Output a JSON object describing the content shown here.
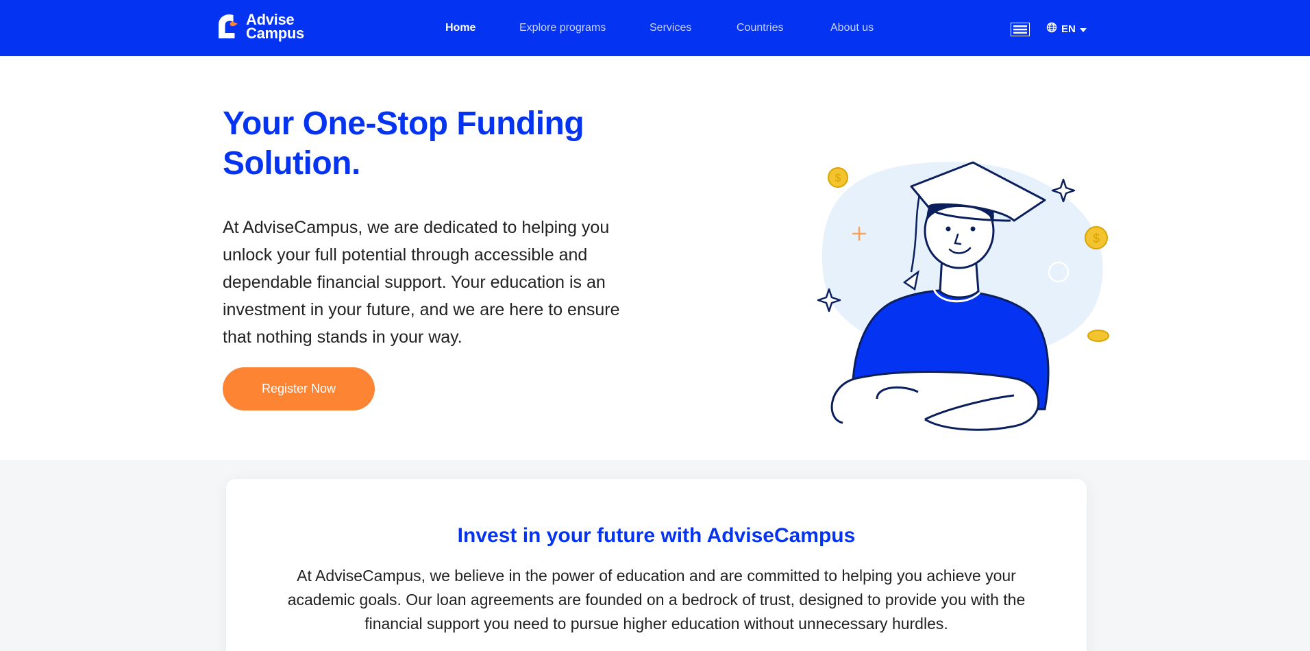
{
  "brand": {
    "line1": "Advise",
    "line2": "Campus",
    "colors": {
      "primary": "#0433f2",
      "accent": "#fd8433",
      "text": "#222222"
    }
  },
  "nav": {
    "links": [
      {
        "label": "Home",
        "active": true
      },
      {
        "label": "Explore programs",
        "active": false
      },
      {
        "label": "Services",
        "active": false
      },
      {
        "label": "Countries",
        "active": false
      },
      {
        "label": "About us",
        "active": false
      }
    ],
    "menu_icon": "hamburger-menu-icon",
    "language_icon": "globe-icon",
    "language": "EN",
    "language_dropdown_icon": "caret-down-icon"
  },
  "hero": {
    "title": "Your One-Stop Funding Solution.",
    "text": "At AdviseCampus, we are dedicated to helping you unlock your full potential through accessible and dependable financial support. Your education is an investment in your future, and we are here to ensure that nothing stands in your way.",
    "cta": "Register Now",
    "illustration_icon": "student-graduate-illustration"
  },
  "invest": {
    "title": "Invest in your future with AdviseCampus",
    "text": "At AdviseCampus, we believe in the power of education and are committed to helping you achieve your academic goals. Our loan agreements are founded on a bedrock of trust, designed to provide you with the financial support you need to pursue higher education without unnecessary hurdles."
  }
}
